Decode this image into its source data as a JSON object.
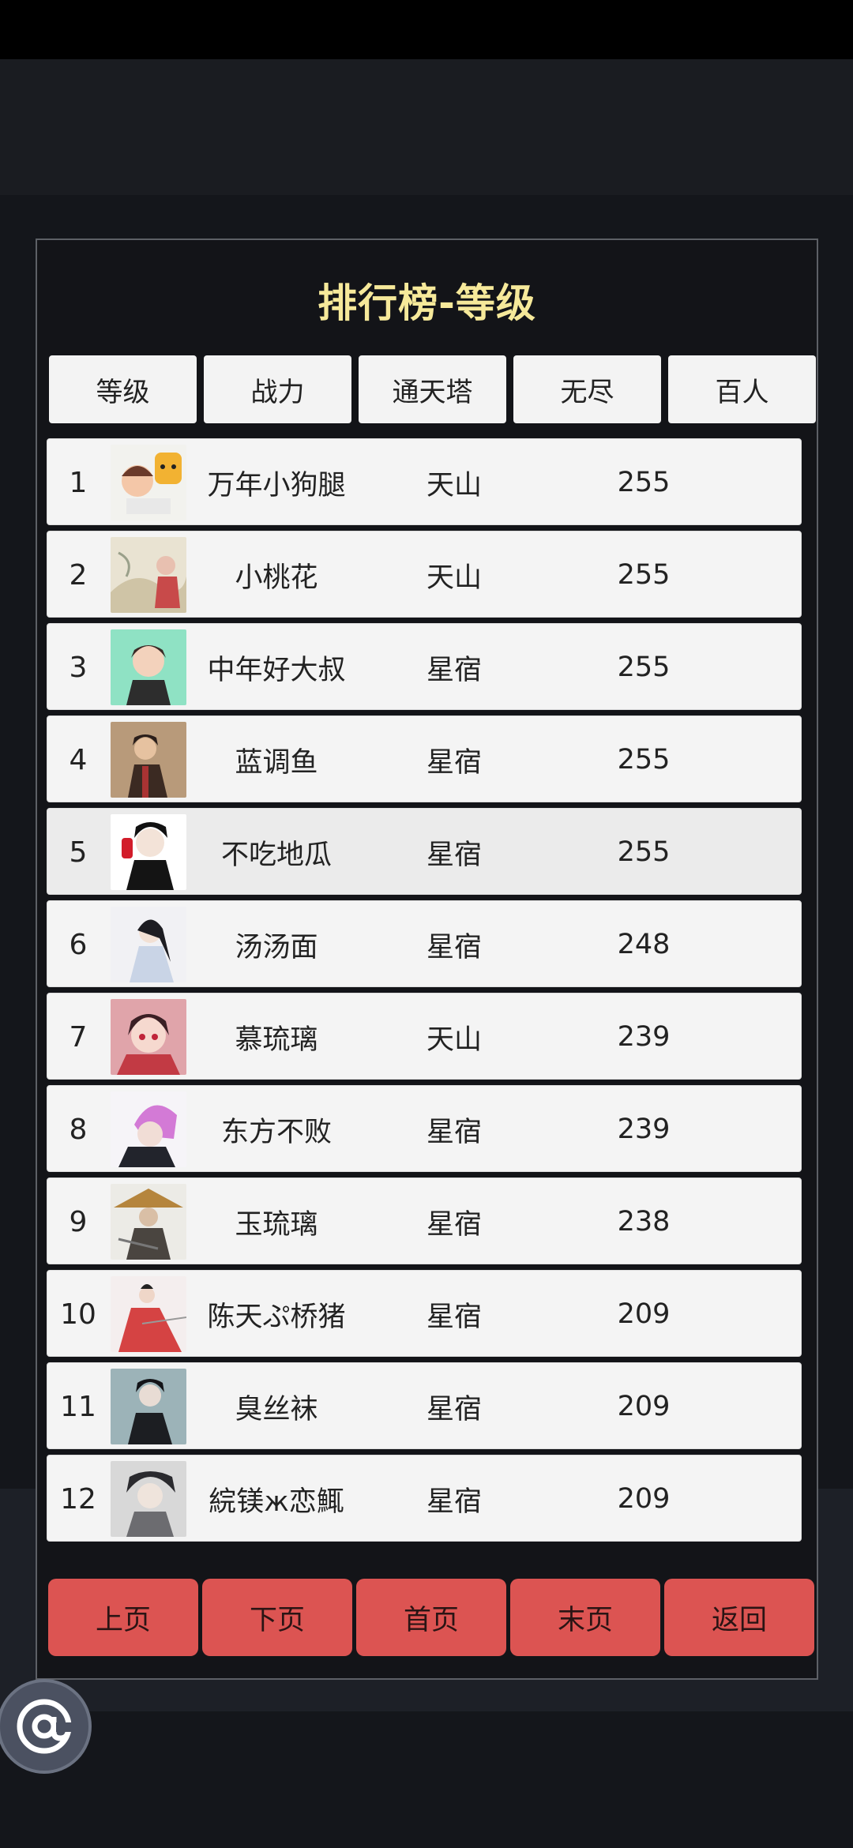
{
  "title": "排行榜-等级",
  "tabs": [
    "等级",
    "战力",
    "通天塔",
    "无尽",
    "百人"
  ],
  "rows": [
    {
      "rank": "1",
      "name": "万年小狗腿",
      "realm": "天山",
      "value": "255"
    },
    {
      "rank": "2",
      "name": "小桃花",
      "realm": "天山",
      "value": "255"
    },
    {
      "rank": "3",
      "name": "中年好大叔",
      "realm": "星宿",
      "value": "255"
    },
    {
      "rank": "4",
      "name": "蓝调鱼",
      "realm": "星宿",
      "value": "255"
    },
    {
      "rank": "5",
      "name": "不吃地瓜",
      "realm": "星宿",
      "value": "255"
    },
    {
      "rank": "6",
      "name": "汤汤面",
      "realm": "星宿",
      "value": "248"
    },
    {
      "rank": "7",
      "name": "慕琉璃",
      "realm": "天山",
      "value": "239"
    },
    {
      "rank": "8",
      "name": "东方不败",
      "realm": "星宿",
      "value": "239"
    },
    {
      "rank": "9",
      "name": "玉琉璃",
      "realm": "星宿",
      "value": "238"
    },
    {
      "rank": "10",
      "name": "陈天ぷ桥猪",
      "realm": "星宿",
      "value": "209"
    },
    {
      "rank": "11",
      "name": "臭丝袜",
      "realm": "星宿",
      "value": "209"
    },
    {
      "rank": "12",
      "name": "綄镁ж恋鮿",
      "realm": "星宿",
      "value": "209"
    }
  ],
  "nav": [
    "上页",
    "下页",
    "首页",
    "末页",
    "返回"
  ],
  "fab_icon": "at-icon",
  "colors": {
    "title": "#f6e99a",
    "nav_button": "#dc5452",
    "tab_bg": "#f3f3f3",
    "row_bg": "#f4f4f4",
    "page_bg": "#14161b"
  }
}
